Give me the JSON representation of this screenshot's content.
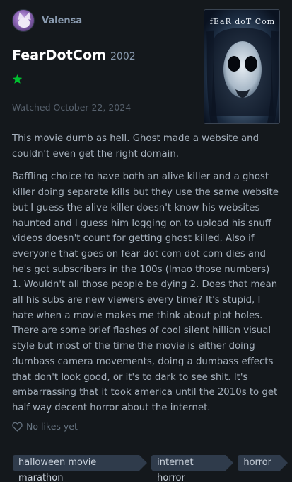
{
  "user": {
    "name": "Valensa"
  },
  "film": {
    "title": "FearDotCom",
    "year": "2002",
    "poster_title": "fEaR doT Com"
  },
  "rating": {
    "stars": 1,
    "color": "#00c030"
  },
  "watched": "Watched October 22, 2024",
  "review": {
    "paragraphs": [
      "This movie dumb as hell. Ghost made a website and couldn't even get the right domain.",
      "Baffling choice to have both an alive killer and a ghost killer doing separate kills but they use the same website but I guess the alive killer doesn't know his websites haunted and I guess him logging on to upload his snuff videos doesn't count for getting ghost killed. Also if everyone that goes on fear dot com dot com dies and he's got subscribers in the 100s (lmao those numbers) 1. Wouldn't all those people be dying 2. Does that mean all his subs are new viewers every time? It's stupid, I hate when a movie makes me think about plot holes. There are some brief flashes of cool silent hillian visual style but most of the time the movie is either doing dumbass camera movements, doing a dumbass effects that don't look good, or it's to dark to see shit. It's embarrassing that it took america until the 2010s to get half way decent horror about the internet."
    ]
  },
  "likes": {
    "text": "No likes yet"
  },
  "tags": [
    "halloween movie marathon",
    "internet horror",
    "horror"
  ]
}
